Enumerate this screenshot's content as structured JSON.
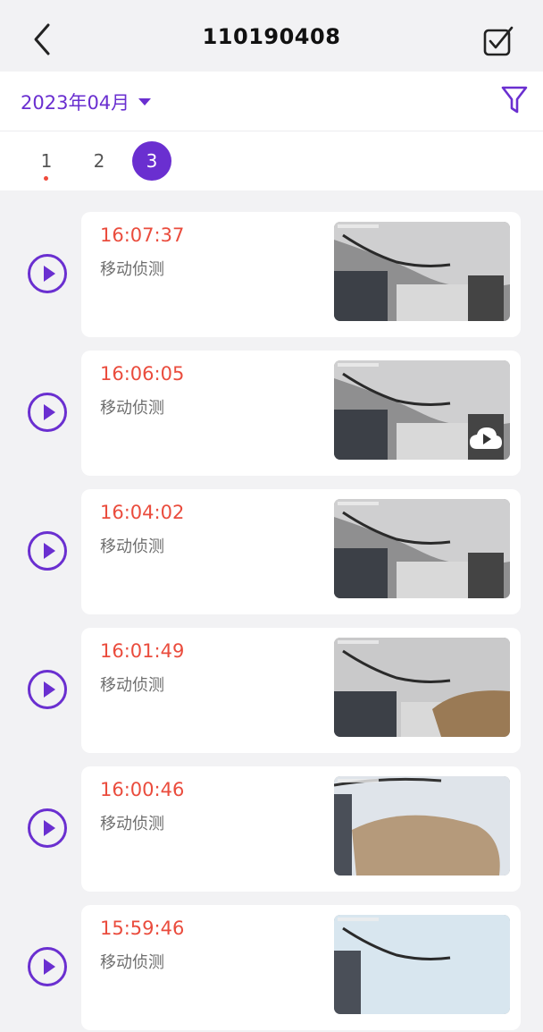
{
  "header": {
    "title": "110190408"
  },
  "filter": {
    "month_label": "2023年04月"
  },
  "pages": [
    "1",
    "2",
    "3"
  ],
  "active_page": "3",
  "events": [
    {
      "time": "16:07:37",
      "label": "移动侦测",
      "thumb": "room-white",
      "cloud": false
    },
    {
      "time": "16:06:05",
      "label": "移动侦测",
      "thumb": "room-white",
      "cloud": true
    },
    {
      "time": "16:04:02",
      "label": "移动侦测",
      "thumb": "room-white",
      "cloud": false
    },
    {
      "time": "16:01:49",
      "label": "移动侦测",
      "thumb": "room-person",
      "cloud": false
    },
    {
      "time": "16:00:46",
      "label": "移动侦测",
      "thumb": "close-up",
      "cloud": false
    },
    {
      "time": "15:59:46",
      "label": "移动侦测",
      "thumb": "bright",
      "cloud": false
    }
  ],
  "colors": {
    "accent": "#6a2fd0",
    "time": "#ea4c3d",
    "dot": "#ef4a3c"
  }
}
